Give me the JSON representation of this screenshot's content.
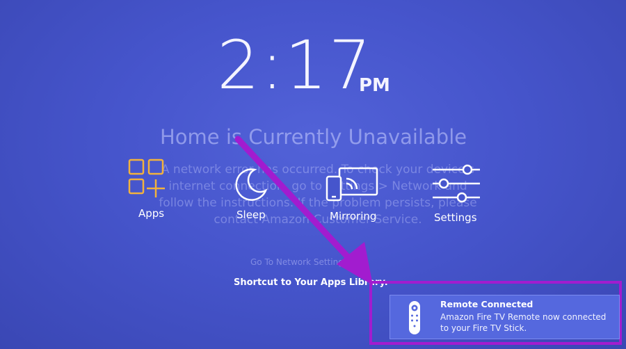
{
  "clock": {
    "time": "2:17",
    "period": "PM"
  },
  "background_error": {
    "title": "Home is Currently Unavailable",
    "message": "A network error has occurred. To check your device's internet connection, go to Settings > Network and follow the instructions. If the problem persists, please contact Amazon Customer Service.",
    "link": "Go To Network Settings"
  },
  "menu": {
    "items": [
      {
        "label": "Apps",
        "icon": "apps-grid-icon"
      },
      {
        "label": "Sleep",
        "icon": "moon-icon"
      },
      {
        "label": "Mirroring",
        "icon": "mirroring-icon"
      },
      {
        "label": "Settings",
        "icon": "sliders-icon"
      }
    ],
    "focused_hint": "Shortcut to Your Apps Library."
  },
  "toast": {
    "title": "Remote Connected",
    "body": "Amazon Fire TV Remote now connected to your Fire TV Stick.",
    "icon": "remote-icon"
  },
  "colors": {
    "background": "#4655cc",
    "apps_accent": "#f2b23d",
    "annotation": "#a21ccf",
    "toast_bg": "#5568de"
  }
}
